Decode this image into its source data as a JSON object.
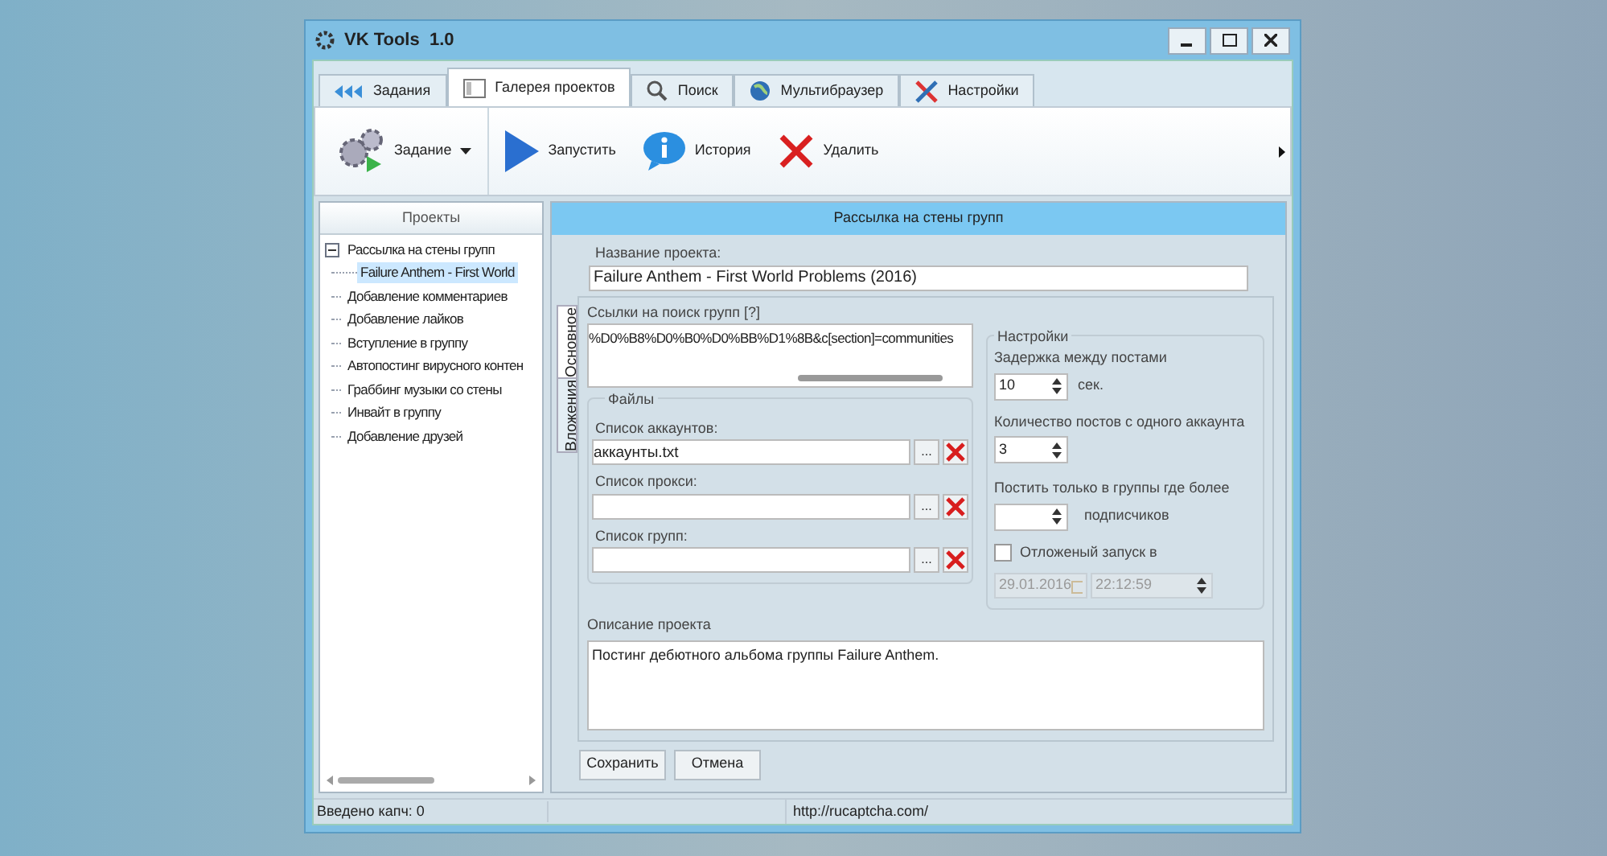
{
  "window": {
    "title": "VK Tools  1.0"
  },
  "tabs": [
    {
      "label": "Задания",
      "selected": false,
      "kind": "tasks"
    },
    {
      "label": "Галерея проектов",
      "selected": true,
      "kind": "gallery"
    },
    {
      "label": "Поиск",
      "selected": false,
      "kind": "search"
    },
    {
      "label": "Мультибраузер",
      "selected": false,
      "kind": "globe"
    },
    {
      "label": "Настройки",
      "selected": false,
      "kind": "settings"
    }
  ],
  "toolbar": [
    {
      "label": "Задание",
      "kind": "gears",
      "dropdown": true
    },
    {
      "label": "Запустить",
      "kind": "play",
      "dropdown": false
    },
    {
      "label": "История",
      "kind": "info",
      "dropdown": false
    },
    {
      "label": "Удалить",
      "kind": "delete",
      "dropdown": false
    }
  ],
  "projects": {
    "title": "Проекты",
    "items": [
      {
        "label": "Рассылка на стены групп",
        "expanded": true,
        "selected": false,
        "children": [
          {
            "label": "Failure Anthem - First World",
            "selected": true
          }
        ]
      },
      {
        "label": "Добавление комментариев",
        "selected": false
      },
      {
        "label": "Добавление лайков",
        "selected": false
      },
      {
        "label": "Вступление в группу",
        "selected": false
      },
      {
        "label": "Автопостинг вирусного контен",
        "selected": false
      },
      {
        "label": "Граббинг музыки со стены",
        "selected": false
      },
      {
        "label": "Инвайт в группу",
        "selected": false
      },
      {
        "label": "Добавление друзей",
        "selected": false
      }
    ]
  },
  "form": {
    "header": "Рассылка на стены групп",
    "name_label": "Название проекта:",
    "name_value": "Failure Anthem - First World Problems (2016)",
    "side_tabs": [
      {
        "label": "Основное",
        "selected": true
      },
      {
        "label": "Вложения",
        "selected": false
      }
    ],
    "links_label": "Ссылки на поиск групп [?]",
    "links_value": "%D0%B8%D0%B0%D0%BB%D1%8B&c[section]=communities",
    "files": {
      "title": "Файлы",
      "fields": [
        {
          "label": "Список аккаунтов:",
          "value": "аккаунты.txt",
          "browse": "..."
        },
        {
          "label": "Список прокси:",
          "browse": "..."
        },
        {
          "label": "Список групп:",
          "browse": "..."
        }
      ]
    },
    "settings": {
      "title": "Настройки",
      "delay_label": "Задержка между постами",
      "delay_value": "10",
      "delay_unit": "сек.",
      "posts_label": "Количество постов с одного аккаунта",
      "posts_value": "3",
      "min_label": "Постить только в группы где более",
      "min_unit": "подписчиков",
      "delayed_label": "Отложеный запуск в",
      "delayed_checked": false,
      "date": "29.01.2016",
      "time": "22:12:59"
    },
    "description_label": "Описание проекта",
    "description_value": "Постинг дебютного альбома группы Failure Anthem.",
    "buttons": [
      "Сохранить",
      "Отмена"
    ]
  },
  "status_bar": [
    "Введено капч: 0",
    "http://rucaptcha.com/"
  ]
}
